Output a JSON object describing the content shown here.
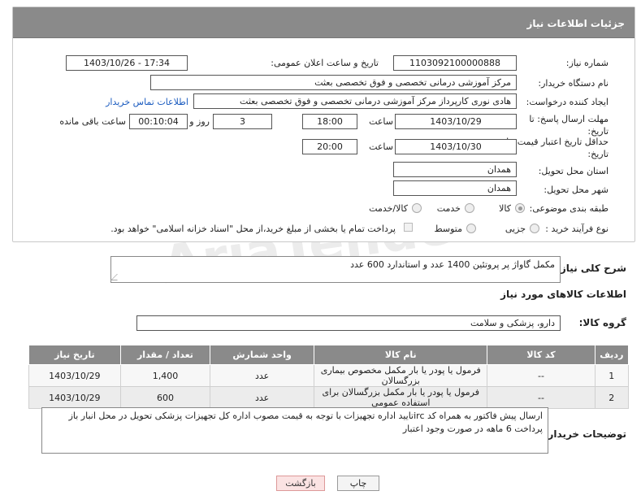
{
  "header": {
    "title": "جزئیات اطلاعات نیاز"
  },
  "fields": {
    "need_number_label": "شماره نیاز:",
    "need_number": "1103092100000888",
    "announce_label": "تاریخ و ساعت اعلان عمومی:",
    "announce_value": "1403/10/26 - 17:34",
    "buyer_org_label": "نام دستگاه خریدار:",
    "buyer_org": "مرکز آموزشی درمانی تخصصی و فوق تخصصی بعثت",
    "requester_label": "ایجاد کننده درخواست:",
    "requester": "هادی نوری کارپرداز مرکز آموزشی درمانی تخصصی و فوق تخصصی بعثت",
    "contact_link": "اطلاعات تماس خریدار",
    "reply_deadline_label": "مهلت ارسال پاسخ: تا تاریخ:",
    "reply_date": "1403/10/29",
    "time_label": "ساعت",
    "reply_time": "18:00",
    "days_value": "3",
    "days_label": "روز و",
    "remaining_value": "00:10:04",
    "remaining_label": "ساعت باقی مانده",
    "price_validity_label": "حداقل تاریخ اعتبار قیمت: تا تاریخ:",
    "price_date": "1403/10/30",
    "price_time": "20:00",
    "province_label": "استان محل تحویل:",
    "province": "همدان",
    "city_label": "شهر محل تحویل:",
    "city": "همدان",
    "category_label": "طبقه بندی موضوعی:",
    "category_options": [
      "کالا",
      "خدمت",
      "کالا/خدمت"
    ],
    "process_label": "نوع فرآیند خرید :",
    "process_options": [
      "جزیی",
      "متوسط"
    ],
    "payment_note": "پرداخت تمام یا بخشی از مبلغ خرید،از محل \"اسناد خزانه اسلامی\" خواهد بود."
  },
  "summary": {
    "label": "شرح کلی نیاز:",
    "text": "مکمل گاواژ پر پروتئین 1400 عدد و استاندارد 600 عدد"
  },
  "goods_info": {
    "title": "اطلاعات کالاهای مورد نیاز",
    "group_label": "گروه کالا:",
    "group_value": "دارو، پزشکی و سلامت"
  },
  "table": {
    "headers": [
      "ردیف",
      "کد کالا",
      "نام کالا",
      "واحد شمارش",
      "تعداد / مقدار",
      "تاریخ نیاز"
    ],
    "rows": [
      [
        "1",
        "--",
        "فرمول یا پودر یا بار مکمل مخصوص بیماری بزرگسالان",
        "عدد",
        "1,400",
        "1403/10/29"
      ],
      [
        "2",
        "--",
        "فرمول یا پودر یا بار مکمل بزرگسالان برای استفاده عمومی",
        "عدد",
        "600",
        "1403/10/29"
      ]
    ]
  },
  "buyer_notes": {
    "label": "توضیحات خریدار:",
    "text": "ارسال پیش فاکتور به همراه کد ircتایید اداره تجهیزات  با توجه به قیمت مصوب اداره کل تجهیزات پزشکی تحویل در محل انبار باز پرداخت 6 ماهه در صورت وجود اعتبار"
  },
  "buttons": {
    "print": "چاپ",
    "back": "بازگشت"
  },
  "watermark": "AriaTender.net"
}
